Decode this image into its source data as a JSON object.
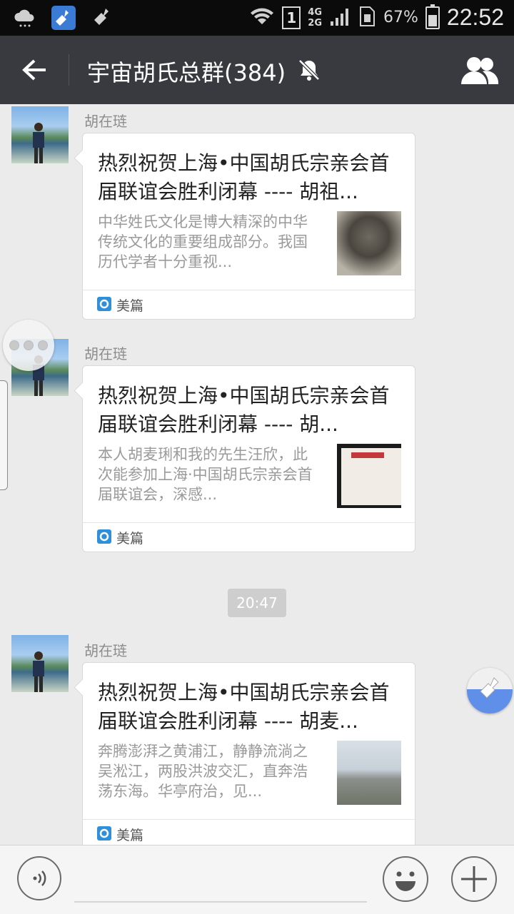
{
  "status_bar": {
    "sim_slot": "1",
    "network_4g": "4G",
    "network_2g": "2G",
    "battery_text": "67%",
    "battery_level": 0.67,
    "time": "22:52"
  },
  "header": {
    "title": "宇宙胡氏总群(384)",
    "muted": true
  },
  "messages": [
    {
      "sender": "胡在琏",
      "card_title": "热烈祝贺上海•中国胡氏宗亲会首届联谊会胜利闭幕 ---- 胡祖...",
      "card_desc": "中华姓氏文化是博大精深的中华传统文化的重要组成部分。我国历代学者十分重视...",
      "source": "美篇"
    },
    {
      "sender": "胡在琏",
      "card_title": "热烈祝贺上海•中国胡氏宗亲会首届联谊会胜利闭幕 ---- 胡...",
      "card_desc": "本人胡麦琍和我的先生汪欣，此次能参加上海·中国胡氏宗亲会首届联谊会，深感...",
      "source": "美篇"
    },
    {
      "sender": "胡在琏",
      "card_title": "热烈祝贺上海•中国胡氏宗亲会首届联谊会胜利闭幕 ---- 胡麦...",
      "card_desc": "奔腾澎湃之黄浦江，静静流淌之吴淞江，两股洪波交汇，直奔浩荡东海。华亭府治，见...",
      "source": "美篇"
    }
  ],
  "timestamp": "20:47",
  "colors": {
    "titlebar_bg": "#393a3f",
    "chat_bg": "#ebebeb",
    "meipian_blue": "#2f8fd8"
  }
}
